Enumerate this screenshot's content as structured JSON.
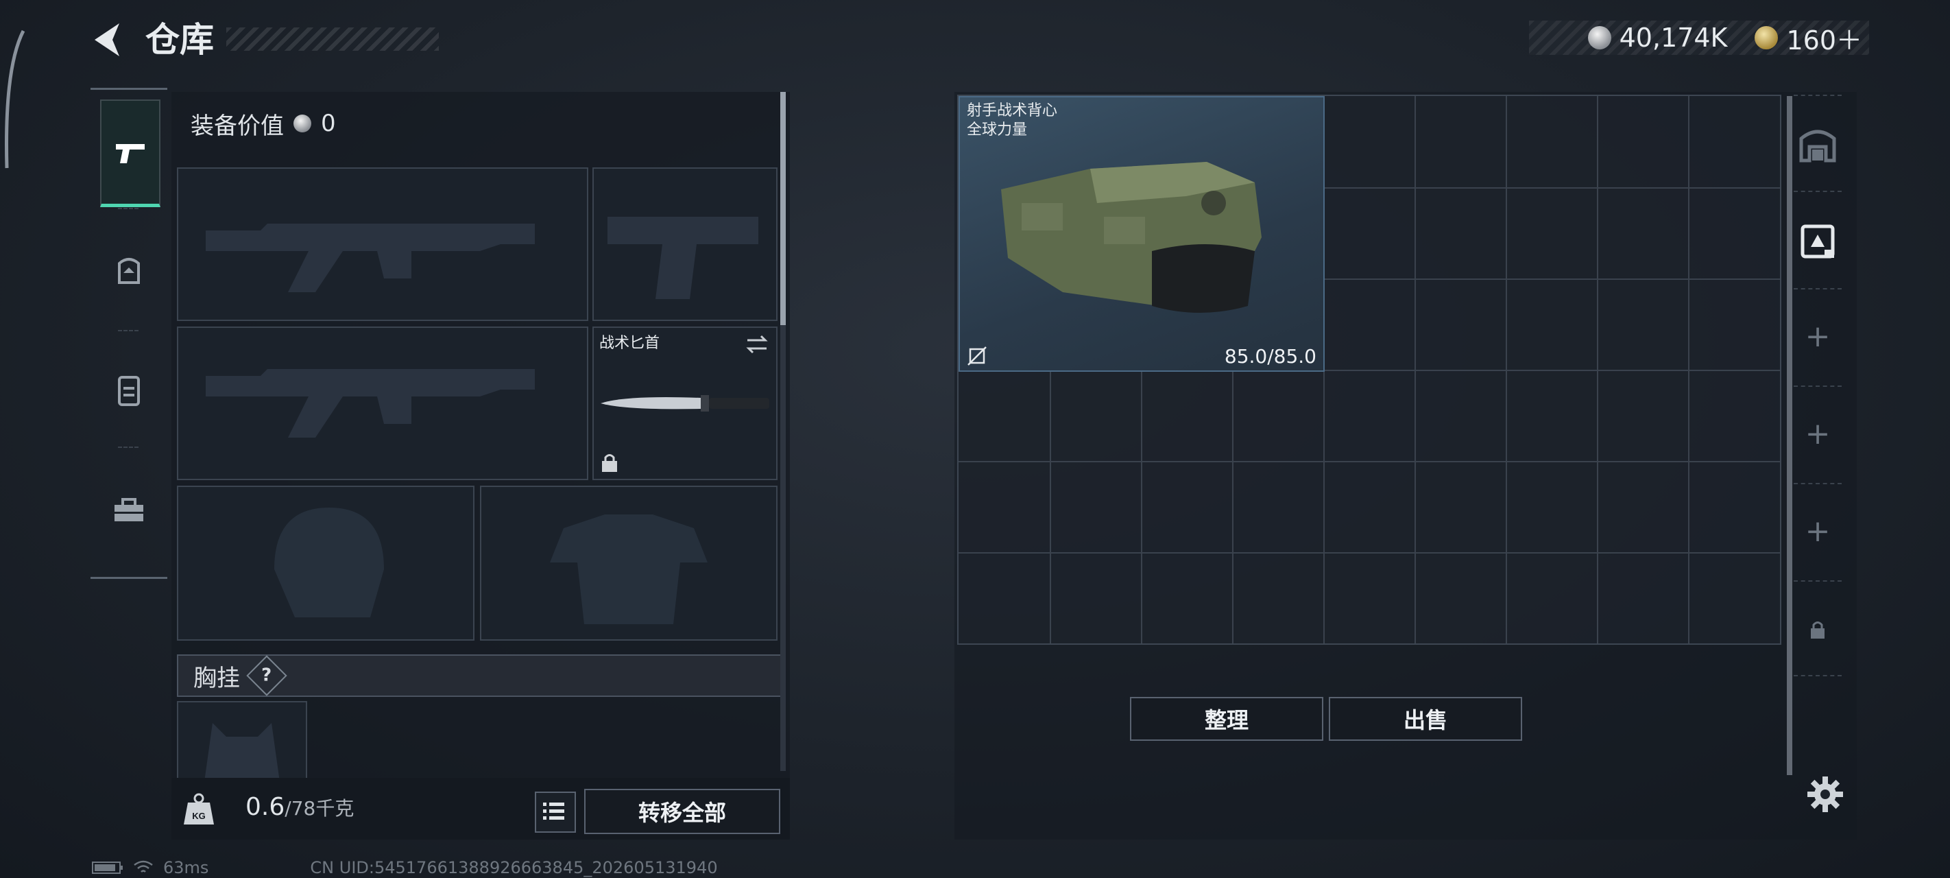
{
  "header": {
    "title": "仓库"
  },
  "currency": {
    "silver": "40,174K",
    "gold": "160＋"
  },
  "rail": {
    "items": [
      "weapons-icon",
      "helmet-icon",
      "backpack-icon",
      "toolbox-icon"
    ],
    "accent": "#4fd6b0"
  },
  "equipment": {
    "value_label": "装备价值",
    "value": "0",
    "melee_label": "战术匕首",
    "chest_label": "胸挂",
    "help_mark": "?",
    "weight": "0.6",
    "weight_max": "/78千克",
    "weight_icon_text": "KG",
    "transfer_label": "转移全部"
  },
  "storage": {
    "item": {
      "name_line1": "射手战术背心",
      "name_line2": "全球力量",
      "durability": "85.0/85.0"
    },
    "sort_label": "整理",
    "sell_label": "出售"
  },
  "side": {
    "plus1": "+",
    "plus2": "+",
    "plus3": "+"
  },
  "status": {
    "ping": "63ms",
    "uid": "CN UID:54517661388926663845_202605131940"
  }
}
